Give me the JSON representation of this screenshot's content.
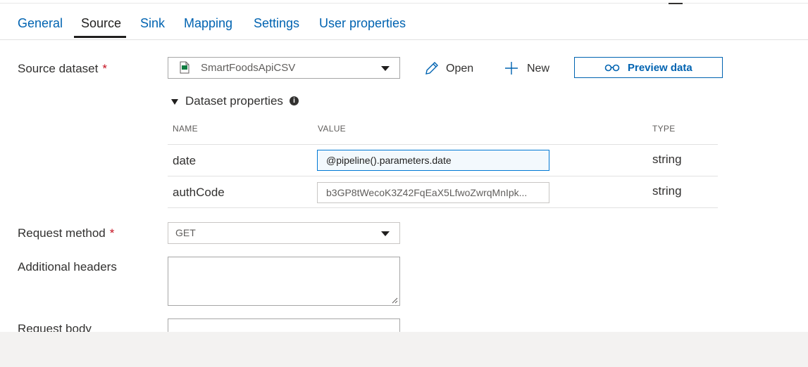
{
  "tabs": [
    {
      "label": "General"
    },
    {
      "label": "Source"
    },
    {
      "label": "Sink"
    },
    {
      "label": "Mapping"
    },
    {
      "label": "Settings"
    },
    {
      "label": "User properties"
    }
  ],
  "active_tab": "Source",
  "source_dataset": {
    "label": "Source dataset",
    "required_mark": "*",
    "value": "SmartFoodsApiCSV",
    "icon": "csv-file-icon"
  },
  "actions": {
    "open_label": "Open",
    "new_label": "New",
    "preview_label": "Preview data"
  },
  "dataset_properties": {
    "title": "Dataset properties",
    "info_glyph": "i",
    "columns": {
      "name": "NAME",
      "value": "VALUE",
      "type": "TYPE"
    },
    "rows": [
      {
        "name": "date",
        "value": "@pipeline().parameters.date",
        "type": "string"
      },
      {
        "name": "authCode",
        "value": "b3GP8tWecoK3Z42FqEaX5LfwoZwrqMnIpk...",
        "type": "string"
      }
    ]
  },
  "request_method": {
    "label": "Request method",
    "required_mark": "*",
    "value": "GET"
  },
  "additional_headers": {
    "label": "Additional headers"
  },
  "request_body": {
    "label": "Request body"
  },
  "colors": {
    "accent": "#0063b1",
    "required": "#c50f1f",
    "text": "#323130"
  }
}
